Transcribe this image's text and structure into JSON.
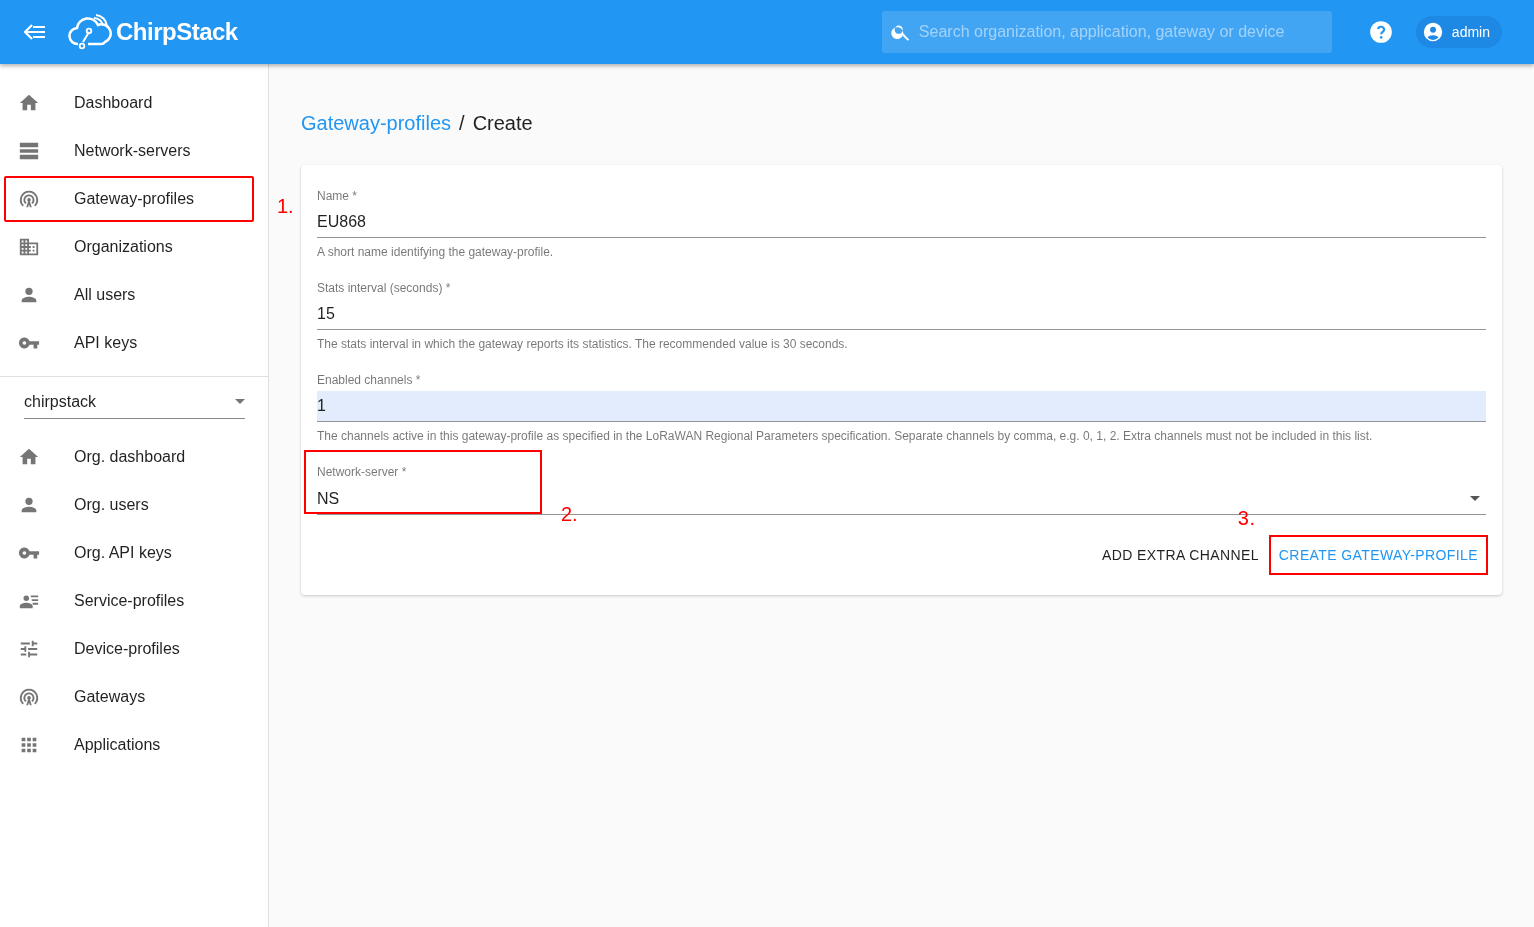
{
  "app_bar": {
    "logo_text": "ChirpStack",
    "search": {
      "placeholder": "Search organization, application, gateway or device"
    },
    "user": "admin"
  },
  "sidebar": {
    "items": [
      {
        "label": "Dashboard",
        "selected": false
      },
      {
        "label": "Network-servers",
        "selected": false
      },
      {
        "label": "Gateway-profiles",
        "selected": false,
        "annotation": "1."
      },
      {
        "label": "Organizations",
        "selected": false
      },
      {
        "label": "All users",
        "selected": false
      },
      {
        "label": "API keys",
        "selected": false
      }
    ],
    "organization_select": {
      "value": "chirpstack"
    },
    "org_items": [
      {
        "label": "Org. dashboard",
        "selected": false
      },
      {
        "label": "Org. users",
        "selected": false
      },
      {
        "label": "Org. API keys",
        "selected": false
      },
      {
        "label": "Service-profiles",
        "selected": false
      },
      {
        "label": "Device-profiles",
        "selected": false
      },
      {
        "label": "Gateways",
        "selected": false
      },
      {
        "label": "Applications",
        "selected": false
      }
    ]
  },
  "breadcrumb": {
    "link": "Gateway-profiles",
    "separator": "/",
    "current": "Create"
  },
  "form": {
    "fields": [
      {
        "kind": "text",
        "label": "Name *",
        "value": "EU868",
        "helper": "A short name identifying the gateway-profile.",
        "autofilled": false
      },
      {
        "kind": "text",
        "label": "Stats interval (seconds) *",
        "value": "15",
        "helper": "The stats interval in which the gateway reports its statistics. The recommended value is 30 seconds.",
        "autofilled": false
      },
      {
        "kind": "text",
        "label": "Enabled channels *",
        "value": "1",
        "helper": "The channels active in this gateway-profile as specified in the LoRaWAN Regional Parameters specification. Separate channels by comma, e.g. 0, 1, 2. Extra channels must not be included in this list.",
        "autofilled": true
      },
      {
        "kind": "select",
        "label": "Network-server *",
        "value": "NS",
        "annotation": "2."
      }
    ],
    "buttons": [
      {
        "label": "ADD EXTRA CHANNEL",
        "primary": false
      },
      {
        "label": "CREATE GATEWAY-PROFILE",
        "primary": true,
        "annotation": "3."
      }
    ]
  }
}
